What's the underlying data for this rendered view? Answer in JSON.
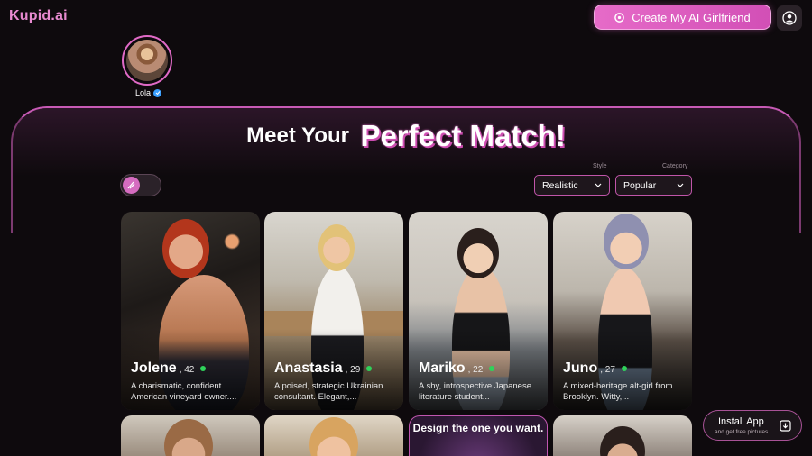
{
  "header": {
    "logo": "Kupid.ai",
    "create_button": "Create My AI Girlfriend",
    "icons": [
      "sparkle-icon",
      "user-icon"
    ]
  },
  "story": {
    "name": "Lola"
  },
  "hero": {
    "title_part1": "Meet Your",
    "title_part2": "Perfect Match!"
  },
  "filters": {
    "style_label": "Style",
    "style_value": "Realistic",
    "category_label": "Category",
    "category_value": "Popular"
  },
  "cards": [
    {
      "name": "Jolene",
      "age": ", 42",
      "desc": "A charismatic, confident American vineyard owner...."
    },
    {
      "name": "Anastasia",
      "age": ", 29",
      "desc": "A poised, strategic Ukrainian consultant. Elegant,..."
    },
    {
      "name": "Mariko",
      "age": ", 22",
      "desc": "A shy, introspective Japanese literature student..."
    },
    {
      "name": "Juno",
      "age": ", 27",
      "desc": "A mixed-heritage alt-girl from Brooklyn. Witty,..."
    }
  ],
  "design_card": {
    "text": "Design the one you want."
  },
  "install": {
    "title": "Install App",
    "subtitle": "and get free pictures"
  },
  "colors": {
    "accent": "#e06ac6",
    "online": "#2fd25a",
    "background": "#0e0a0d"
  }
}
